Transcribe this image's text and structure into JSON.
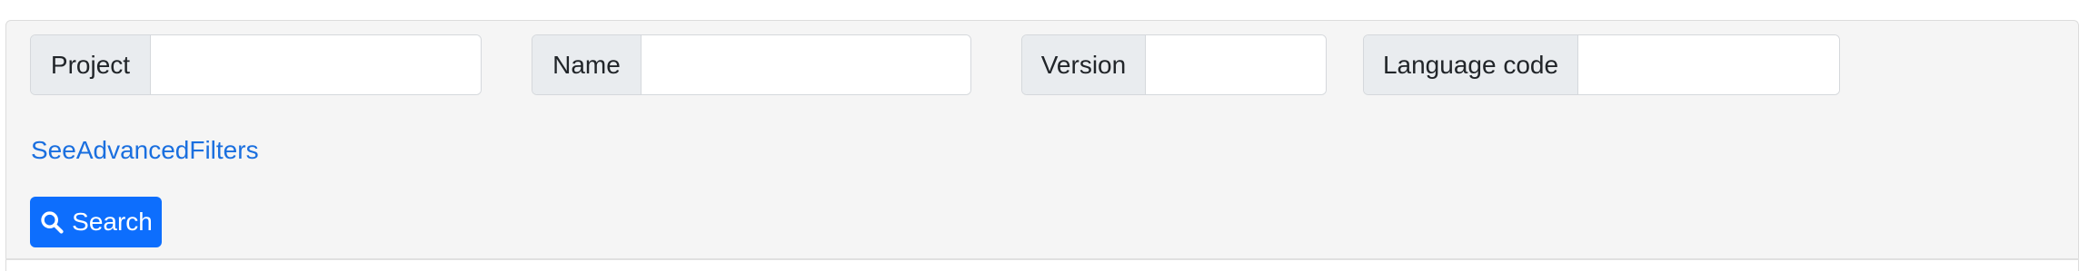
{
  "filters": {
    "project": {
      "label": "Project",
      "value": "",
      "placeholder": ""
    },
    "name": {
      "label": "Name",
      "value": "",
      "placeholder": ""
    },
    "version": {
      "label": "Version",
      "value": "",
      "placeholder": ""
    },
    "language_code": {
      "label": "Language code",
      "value": "",
      "placeholder": ""
    }
  },
  "advanced_link": {
    "label": "SeeAdvancedFilters"
  },
  "search_button": {
    "label": "Search",
    "icon": "search-icon"
  },
  "colors": {
    "panel_background": "#f5f5f5",
    "addon_background": "#e9ecef",
    "link": "#1a6fdf",
    "primary": "#0d6efd"
  }
}
